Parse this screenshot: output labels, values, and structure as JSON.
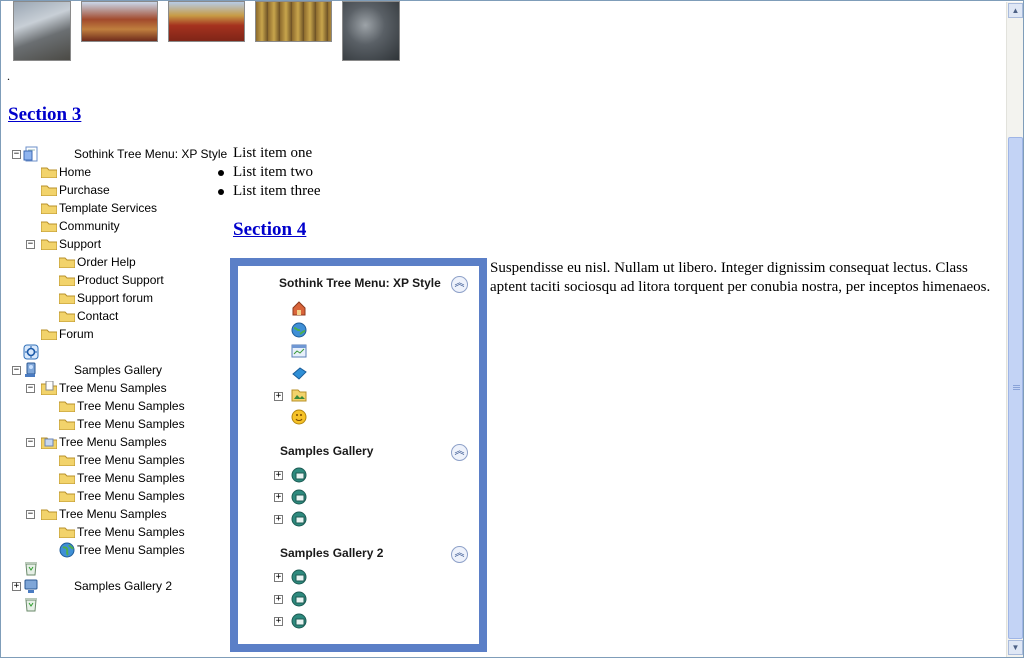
{
  "thumbnails": [
    "great-wall",
    "temple-roof",
    "red-palace",
    "golden-doors",
    "stone-carving"
  ],
  "dot_text": ".",
  "section3": {
    "title": "Section 3"
  },
  "section4": {
    "title": "Section 4"
  },
  "left_tree": {
    "root1": "Sothink Tree Menu: XP Style",
    "items1": [
      "Home",
      "Purchase",
      "Template Services",
      "Community",
      "Support",
      "Order Help",
      "Product Support",
      "Support forum",
      "Contact",
      "Forum"
    ],
    "root2": "Samples Gallery",
    "items2": [
      "Tree Menu Samples",
      "Tree Menu Samples",
      "Tree Menu Samples",
      "Tree Menu Samples",
      "Tree Menu Samples",
      "Tree Menu Samples",
      "Tree Menu Samples",
      "Tree Menu Samples",
      "Tree Menu Samples",
      "Tree Menu Samples"
    ],
    "root3": "Samples Gallery 2"
  },
  "list_items": [
    "List item one",
    "List item two",
    "List item three"
  ],
  "panel": {
    "group1": "Sothink Tree Menu: XP Style",
    "group2": "Samples Gallery",
    "group3": "Samples Gallery 2",
    "collapse_glyph": "︽"
  },
  "paragraph": "Suspendisse eu nisl. Nullam ut libero. Integer dignissim consequat lectus. Class aptent taciti sociosqu ad litora torquent per conubia nostra, per inceptos himenaeos.",
  "colors": {
    "link": "#0000cc",
    "panel_border": "#5b7fc7",
    "folder": "#f2d36b"
  }
}
